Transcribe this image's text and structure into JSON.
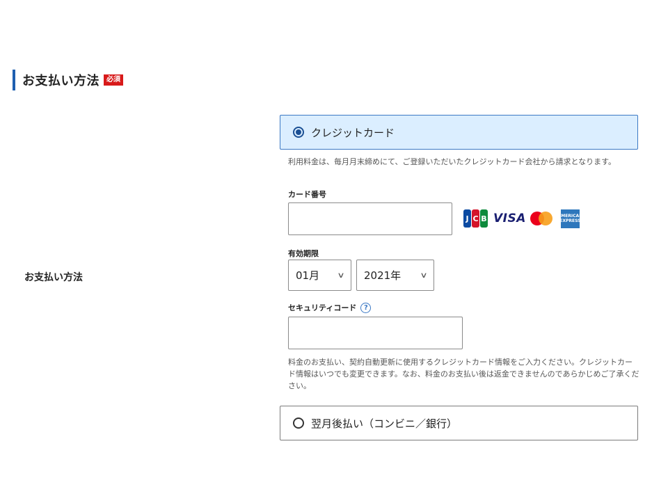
{
  "section": {
    "title": "お支払い方法",
    "required_badge": "必須"
  },
  "row_label": "お支払い方法",
  "options": {
    "credit_card": {
      "label": "クレジットカード",
      "selected": true
    },
    "deferred": {
      "label": "翌月後払い（コンビニ／銀行）",
      "selected": false
    }
  },
  "notes": {
    "billing": "利用料金は、毎月月末締めにて、ご登録いただいたクレジットカード会社から請求となります。",
    "card_info": "料金のお支払い、契約自動更新に使用するクレジットカード情報をご入力ください。クレジットカード情報はいつでも変更できます。なお、料金のお支払い後は返金できませんのであらかじめご了承ください。"
  },
  "card_number": {
    "label": "カード番号",
    "value": "",
    "placeholder": ""
  },
  "brands": {
    "jcb": [
      "J",
      "C",
      "B"
    ],
    "visa": "VISA",
    "amex_line1": "AMERICAN",
    "amex_line2": "EXPRESS"
  },
  "expiry": {
    "label": "有効期限",
    "month": "01月",
    "year": "2021年"
  },
  "security_code": {
    "label": "セキュリティコード",
    "help": "?",
    "value": ""
  },
  "colors": {
    "accent": "#1f5fb0",
    "required": "#d81a1a",
    "selected_bg": "#dbeeff"
  }
}
